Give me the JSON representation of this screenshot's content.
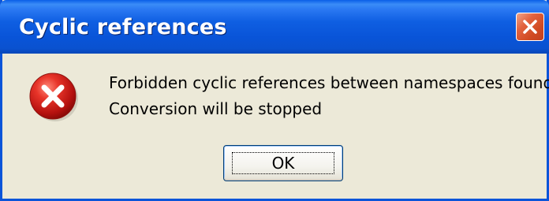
{
  "window": {
    "title": "Cyclic references"
  },
  "dialog": {
    "icon": "error-icon",
    "message_lines": [
      "Forbidden cyclic references between namespaces found!",
      "Conversion will be stopped"
    ],
    "ok_label": "OK"
  },
  "colors": {
    "titlebar": "#0a52d0",
    "window_background": "#ece9d8",
    "close_button": "#d04a22",
    "error_icon": "#d21e1e"
  }
}
